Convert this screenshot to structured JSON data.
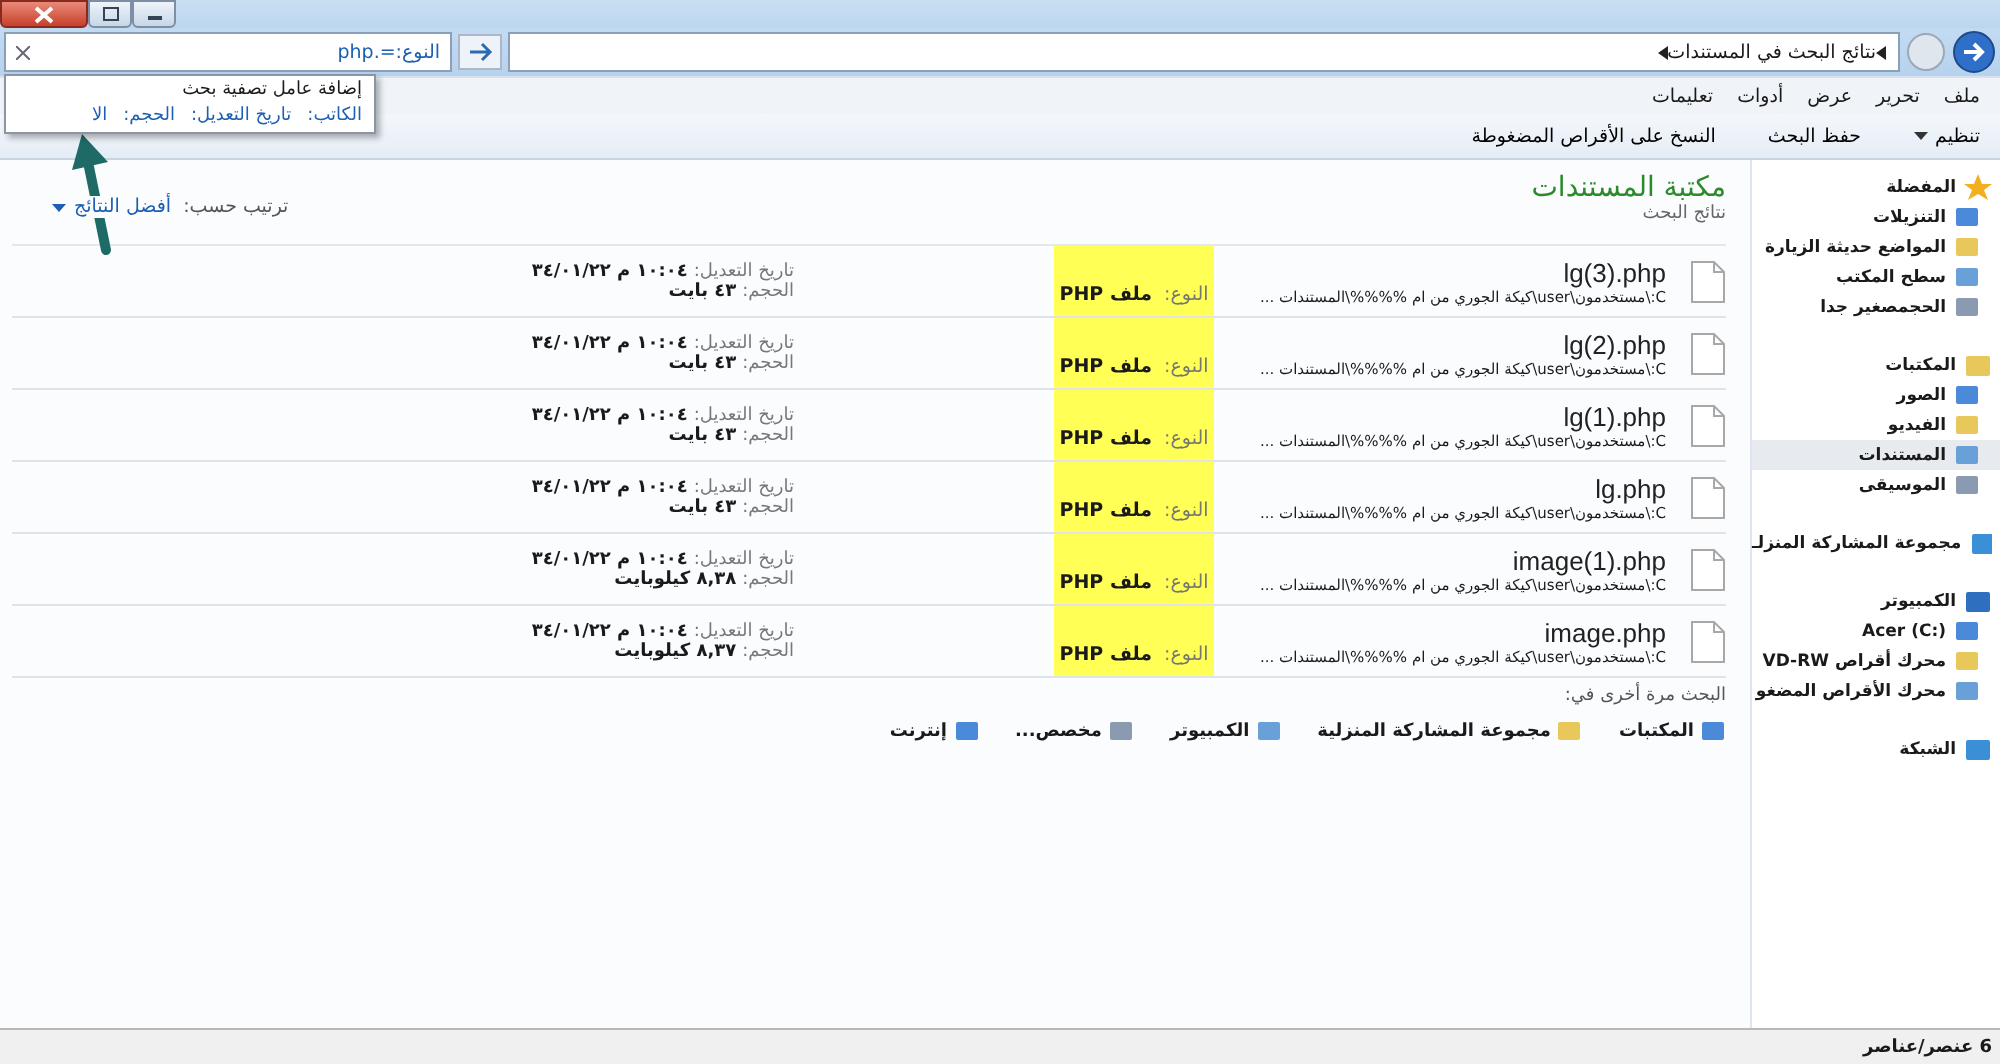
{
  "address_bar": {
    "breadcrumb": "نتائج البحث في المستندات"
  },
  "search": {
    "value": "النوع:=.php"
  },
  "search_suggestions": {
    "title": "إضافة عامل تصفية بحث",
    "filters": [
      "الكاتب:",
      "تاريخ التعديل:",
      "الحجم:",
      "الا"
    ]
  },
  "menu": [
    "ملف",
    "تحرير",
    "عرض",
    "أدوات",
    "تعليمات"
  ],
  "toolbar": [
    {
      "label": "تنظيم",
      "dropdown": true
    },
    {
      "label": "حفظ البحث",
      "dropdown": false
    },
    {
      "label": "النسخ على الأقراص المضغوطة",
      "dropdown": false
    }
  ],
  "library": {
    "title": "مكتبة المستندات",
    "subtitle": "نتائج البحث",
    "sort_label": "ترتيب حسب:",
    "sort_value": "أفضل النتائج"
  },
  "results": [
    {
      "name": "lg(3).php",
      "path": "C:\\مستخدمون\\user\\كيكة الجوري من ام %%%%\\المستندات ...",
      "type_label": "النوع:",
      "type": "ملف PHP",
      "modified_label": "تاريخ التعديل:",
      "modified": "١٠:٠٤ م ٣٤/٠١/٢٢",
      "size_label": "الحجم:",
      "size": "٤٣ بايت",
      "highlighted": true
    },
    {
      "name": "lg(2).php",
      "path": "C:\\مستخدمون\\user\\كيكة الجوري من ام %%%%\\المستندات ...",
      "type_label": "النوع:",
      "type": "ملف PHP",
      "modified_label": "تاريخ التعديل:",
      "modified": "١٠:٠٤ م ٣٤/٠١/٢٢",
      "size_label": "الحجم:",
      "size": "٤٣ بايت",
      "highlighted": true
    },
    {
      "name": "lg(1).php",
      "path": "C:\\مستخدمون\\user\\كيكة الجوري من ام %%%%\\المستندات ...",
      "type_label": "النوع:",
      "type": "ملف PHP",
      "modified_label": "تاريخ التعديل:",
      "modified": "١٠:٠٤ م ٣٤/٠١/٢٢",
      "size_label": "الحجم:",
      "size": "٤٣ بايت",
      "highlighted": true
    },
    {
      "name": "lg.php",
      "path": "C:\\مستخدمون\\user\\كيكة الجوري من ام %%%%\\المستندات ...",
      "type_label": "النوع:",
      "type": "ملف PHP",
      "modified_label": "تاريخ التعديل:",
      "modified": "١٠:٠٤ م ٣٤/٠١/٢٢",
      "size_label": "الحجم:",
      "size": "٤٣ بايت",
      "highlighted": true
    },
    {
      "name": "image(1).php",
      "path": "C:\\مستخدمون\\user\\كيكة الجوري من ام %%%%\\المستندات ...",
      "type_label": "النوع:",
      "type": "ملف PHP",
      "modified_label": "تاريخ التعديل:",
      "modified": "١٠:٠٤ م ٣٤/٠١/٢٢",
      "size_label": "الحجم:",
      "size": "٨,٣٨ كيلوبايت",
      "highlighted": true
    },
    {
      "name": "image.php",
      "path": "C:\\مستخدمون\\user\\كيكة الجوري من ام %%%%\\المستندات ...",
      "type_label": "النوع:",
      "type": "ملف PHP",
      "modified_label": "تاريخ التعديل:",
      "modified": "١٠:٠٤ م ٣٤/٠١/٢٢",
      "size_label": "الحجم:",
      "size": "٨,٣٧ كيلوبايت",
      "highlighted": true
    }
  ],
  "search_again": {
    "label": "البحث مرة أخرى في:",
    "locations": [
      "المكتبات",
      "مجموعة المشاركة المنزلية",
      "الكمبيوتر",
      "مخصص...",
      "إنترنت"
    ]
  },
  "sidebar": {
    "groups": [
      {
        "label": "المفضلة",
        "children": [
          {
            "label": "التنزيلات",
            "selected": false
          },
          {
            "label": "المواضع حديثة الزيارة",
            "selected": false
          },
          {
            "label": "سطح المكتب",
            "selected": false
          },
          {
            "label": "الحجمصغير جدا",
            "selected": false
          }
        ]
      },
      {
        "label": "المكتبات",
        "children": [
          {
            "label": "الصور",
            "selected": false
          },
          {
            "label": "الفيديو",
            "selected": false
          },
          {
            "label": "المستندات",
            "selected": true
          },
          {
            "label": "الموسيقى",
            "selected": false
          }
        ]
      },
      {
        "label": "مجموعة المشاركة المنزلـ"
      },
      {
        "label": "الكمبيوتر",
        "children": [
          {
            "label": "Acer (C:)",
            "selected": false
          },
          {
            "label": "محرك أقراص VD-RW",
            "selected": false
          },
          {
            "label": "محرك الأقراص المضغو",
            "selected": false
          }
        ]
      },
      {
        "label": "الشبكة"
      }
    ]
  },
  "status_bar": {
    "count": "6 عنصر/عناصر"
  }
}
